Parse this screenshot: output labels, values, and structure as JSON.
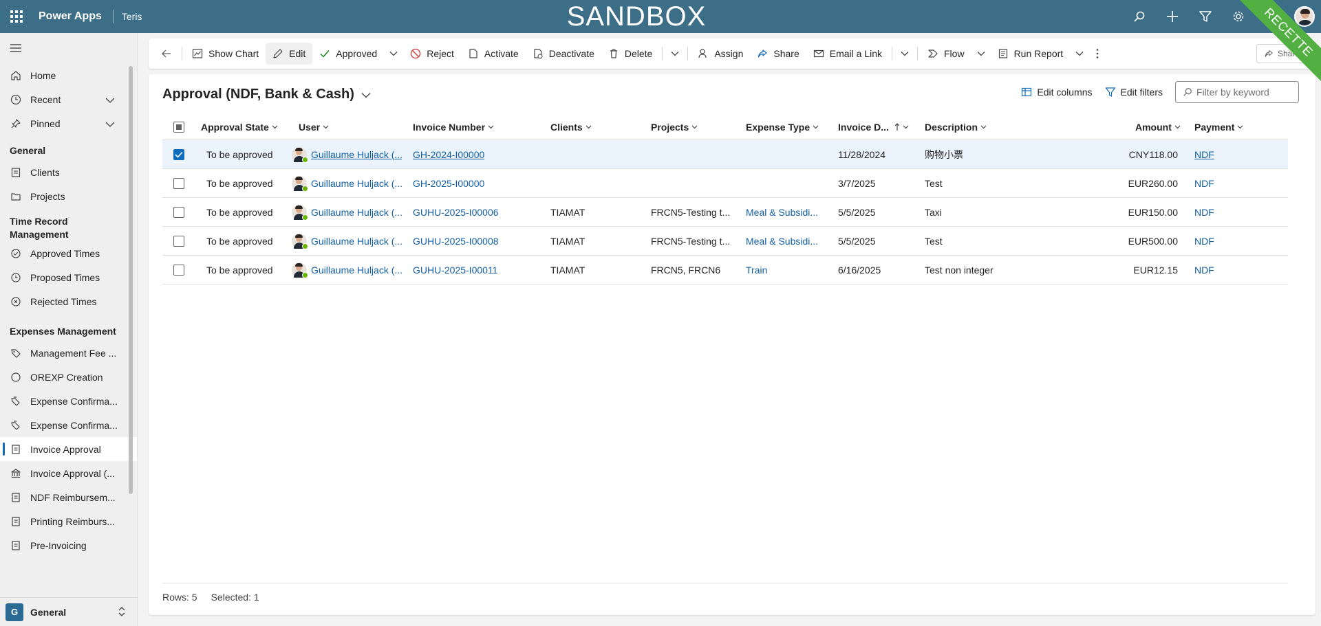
{
  "topbar": {
    "app_name": "Power Apps",
    "environment": "Teris",
    "banner": "SANDBOX",
    "ribbon": "RECETTE",
    "icons": [
      "search-icon",
      "plus-icon",
      "filter-icon",
      "settings-icon",
      "help-icon",
      "user-avatar"
    ]
  },
  "sidebar": {
    "top": [
      {
        "label": "Home",
        "icon": "home-icon"
      },
      {
        "label": "Recent",
        "icon": "clock-icon"
      },
      {
        "label": "Pinned",
        "icon": "pin-icon"
      }
    ],
    "sections": {
      "general": "General",
      "time": "Time Record Management",
      "expenses": "Expenses Management"
    },
    "general_items": [
      {
        "label": "Clients"
      },
      {
        "label": "Projects"
      }
    ],
    "time_items": [
      {
        "label": "Approved Times"
      },
      {
        "label": "Proposed Times"
      },
      {
        "label": "Rejected Times"
      }
    ],
    "expense_items": [
      {
        "label": "Management Fee ..."
      },
      {
        "label": "OREXP Creation"
      },
      {
        "label": "Expense Confirma..."
      },
      {
        "label": "Expense Confirma..."
      },
      {
        "label": "Invoice Approval"
      },
      {
        "label": "Invoice Approval (..."
      },
      {
        "label": "NDF Reimbursem..."
      },
      {
        "label": "Printing Reimburs..."
      },
      {
        "label": "Pre-Invoicing"
      }
    ],
    "area": {
      "badge": "G",
      "label": "General"
    }
  },
  "commands": {
    "show_chart": "Show Chart",
    "edit": "Edit",
    "approved": "Approved",
    "reject": "Reject",
    "activate": "Activate",
    "deactivate": "Deactivate",
    "delete": "Delete",
    "assign": "Assign",
    "share": "Share",
    "email_link": "Email a Link",
    "flow": "Flow",
    "run_report": "Run Report",
    "share_right": "Share"
  },
  "view": {
    "title": "Approval (NDF, Bank & Cash)",
    "edit_columns": "Edit columns",
    "edit_filters": "Edit filters",
    "filter_placeholder": "Filter by keyword"
  },
  "grid": {
    "headers": {
      "state": "Approval State",
      "user": "User",
      "invoice_number": "Invoice Number",
      "clients": "Clients",
      "projects": "Projects",
      "expense_type": "Expense Type",
      "invoice_date": "Invoice D...",
      "description": "Description",
      "amount": "Amount",
      "payment": "Payment"
    },
    "rows": [
      {
        "selected": true,
        "state": "To be approved",
        "user": "Guillaume Huljack (...",
        "invoice_number": "GH-2024-I00000",
        "clients": "",
        "projects": "",
        "expense_type": "",
        "invoice_date": "11/28/2024",
        "description": "购物小票",
        "amount": "CNY118.00",
        "payment": "NDF"
      },
      {
        "selected": false,
        "state": "To be approved",
        "user": "Guillaume Huljack (...",
        "invoice_number": "GH-2025-I00000",
        "clients": "",
        "projects": "",
        "expense_type": "",
        "invoice_date": "3/7/2025",
        "description": "Test",
        "amount": "EUR260.00",
        "payment": "NDF"
      },
      {
        "selected": false,
        "state": "To be approved",
        "user": "Guillaume Huljack (...",
        "invoice_number": "GUHU-2025-I00006",
        "clients": "TIAMAT",
        "projects": "FRCN5-Testing t...",
        "expense_type": "Meal & Subsidi...",
        "invoice_date": "5/5/2025",
        "description": "Taxi",
        "amount": "EUR150.00",
        "payment": "NDF"
      },
      {
        "selected": false,
        "state": "To be approved",
        "user": "Guillaume Huljack (...",
        "invoice_number": "GUHU-2025-I00008",
        "clients": "TIAMAT",
        "projects": "FRCN5-Testing t...",
        "expense_type": "Meal & Subsidi...",
        "invoice_date": "5/5/2025",
        "description": "Test",
        "amount": "EUR500.00",
        "payment": "NDF"
      },
      {
        "selected": false,
        "state": "To be approved",
        "user": "Guillaume Huljack (...",
        "invoice_number": "GUHU-2025-I00011",
        "clients": "TIAMAT",
        "projects": "FRCN5,  FRCN6",
        "expense_type": "Train",
        "invoice_date": "6/16/2025",
        "description": "Test non integer",
        "amount": "EUR12.15",
        "payment": "NDF"
      }
    ],
    "footer": {
      "rows": "Rows: 5",
      "selected": "Selected: 1"
    }
  },
  "colors": {
    "topbar": "#3c6e87",
    "accent": "#0f6cbd",
    "ribbon": "#52b043",
    "link": "#115ea3"
  }
}
